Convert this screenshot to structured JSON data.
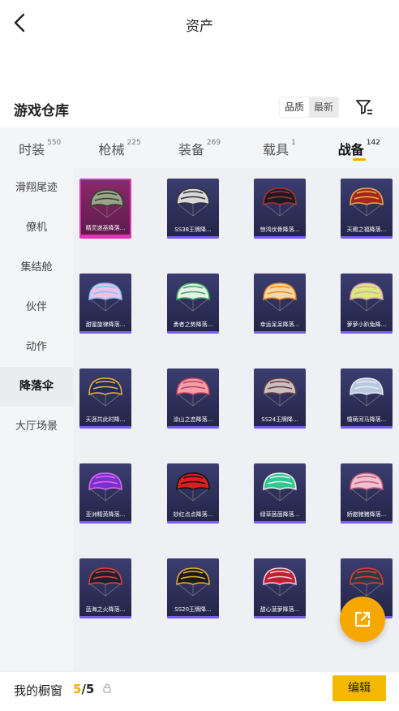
{
  "header": {
    "title": "资产"
  },
  "section": {
    "title": "游戏仓库",
    "sort_quality": "品质",
    "sort_latest": "最新"
  },
  "categories": [
    {
      "label": "时装",
      "count": "550"
    },
    {
      "label": "枪械",
      "count": "225"
    },
    {
      "label": "装备",
      "count": "269"
    },
    {
      "label": "载具",
      "count": "1"
    },
    {
      "label": "战备",
      "count": "142"
    }
  ],
  "sidebar": [
    "滑翔尾迹",
    "僚机",
    "集结舱",
    "伙伴",
    "动作",
    "降落伞",
    "大厅场景"
  ],
  "items": [
    {
      "name": "精灵迷巫降落..."
    },
    {
      "name": "SS38王牌降..."
    },
    {
      "name": "惊鸿伏骨降落..."
    },
    {
      "name": "天赐之福降落..."
    },
    {
      "name": "甜蜜旋律降落..."
    },
    {
      "name": "勇者之势降落..."
    },
    {
      "name": "幸运呆呆降落..."
    },
    {
      "name": "萝萝小趴兔降..."
    },
    {
      "name": "天涯共此时降..."
    },
    {
      "name": "涂山之恋降落..."
    },
    {
      "name": "SS24王牌降..."
    },
    {
      "name": "憧萌河马降落..."
    },
    {
      "name": "亚洲精英降落..."
    },
    {
      "name": "妙红点点降落..."
    },
    {
      "name": "绿草茵茵降落..."
    },
    {
      "name": "娇憨猪猪降落..."
    },
    {
      "name": "蓝海之火降落..."
    },
    {
      "name": "SS20王牌降..."
    },
    {
      "name": "甜心菠萝降落..."
    },
    {
      "name": ""
    }
  ],
  "bottom": {
    "label": "我的橱窗",
    "current": "5",
    "total": "/5",
    "edit": "编辑"
  },
  "colors": {
    "accent": "#f5a800",
    "card_bg": "#2f3160",
    "selected": "#e034b8"
  }
}
